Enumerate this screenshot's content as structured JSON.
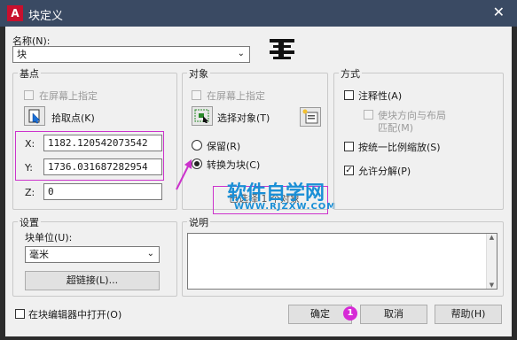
{
  "window": {
    "title": "块定义",
    "app_icon": "A"
  },
  "name": {
    "label": "名称(N):",
    "value": "块"
  },
  "base_point": {
    "group_title": "基点",
    "specify_on_screen": "在屏幕上指定",
    "pick_point": "拾取点(K)",
    "x_label": "X:",
    "x_value": "1182.120542073542",
    "y_label": "Y:",
    "y_value": "1736.031687282954",
    "z_label": "Z:",
    "z_value": "0"
  },
  "objects": {
    "group_title": "对象",
    "specify_on_screen": "在屏幕上指定",
    "select_objects": "选择对象(T)",
    "retain": "保留(R)",
    "convert_to_block": "转换为块(C)",
    "selected_note": "已选择 1 个对象"
  },
  "behavior": {
    "group_title": "方式",
    "annotative": "注释性(A)",
    "match_orientation": "使块方向与布局",
    "match_orientation_2": "匹配(M)",
    "scale_uniformly": "按统一比例缩放(S)",
    "allow_exploding": "允许分解(P)"
  },
  "settings": {
    "group_title": "设置",
    "block_unit_label": "块单位(U):",
    "block_unit_value": "毫米",
    "hyperlink": "超链接(L)..."
  },
  "description": {
    "group_title": "说明"
  },
  "footer": {
    "open_in_editor": "在块编辑器中打开(O)",
    "ok": "确定",
    "cancel": "取消",
    "help": "帮助(H)"
  },
  "annotation": {
    "badge": "1"
  },
  "watermark": {
    "title": "软件自学网",
    "url": "WWW.RJZXW.COM"
  },
  "colors": {
    "accent": "#cc33cc",
    "titlebar": "#3a4a63",
    "watermark": "#1a8fd6"
  }
}
